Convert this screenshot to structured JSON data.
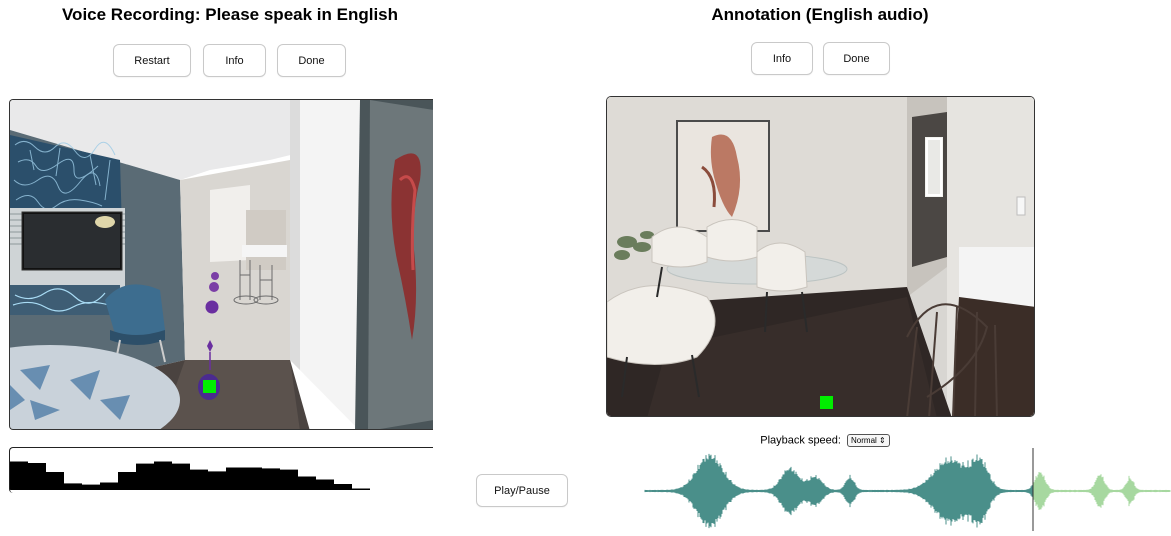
{
  "left_panel": {
    "title": "Voice Recording: Please speak in English",
    "buttons": {
      "restart_label": "Restart",
      "info_label": "Info",
      "done_label": "Done"
    },
    "recording_bar_levels": [
      0.95,
      0.9,
      0.6,
      0.22,
      0.18,
      0.25,
      0.6,
      0.88,
      0.95,
      0.88,
      0.68,
      0.62,
      0.75,
      0.75,
      0.72,
      0.68,
      0.45,
      0.35,
      0.2,
      0.05
    ]
  },
  "right_panel": {
    "title": "Annotation (English audio)",
    "buttons": {
      "info_label": "Info",
      "done_label": "Done",
      "play_pause_label": "Play/Pause"
    },
    "playback_speed": {
      "label": "Playback speed:",
      "selected": "Normal"
    },
    "waveform": {
      "played_color": "#4a8f8a",
      "unplayed_color": "#a7d8a0",
      "playhead_fraction": 0.74
    }
  },
  "colors": {
    "marker_green": "#00ee00",
    "path_purple": "#6a2fa0"
  }
}
